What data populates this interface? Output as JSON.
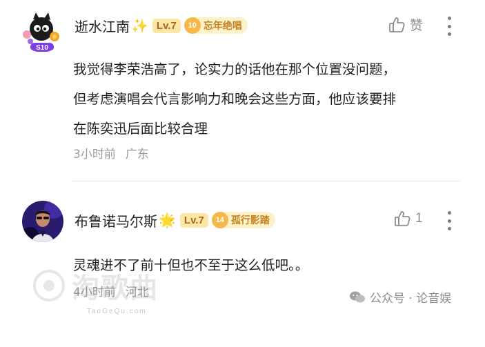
{
  "comments": [
    {
      "username": "逝水江南",
      "deco": "✨",
      "level": "Lv.7",
      "fan_badge_level": "10",
      "fan_badge_name": "忘年绝唱",
      "avatar_label": "S10",
      "like_label": "赞",
      "content_lines": [
        "我觉得李荣浩高了，论实力的话他在那个位置没问题，",
        "但考虑演唱会代言影响力和晚会这些方面，他应该要排",
        "在陈奕迅后面比较合理"
      ],
      "time": "3小时前",
      "location": "广东"
    },
    {
      "username": "布鲁诺马尔斯",
      "deco": "🌟",
      "level": "Lv.7",
      "fan_badge_level": "14",
      "fan_badge_name": "孤行影踏",
      "like_label": "1",
      "content_lines": [
        "灵魂进不了前十但也不至于这么低吧。。"
      ],
      "time": "4小时前",
      "location": "河北"
    }
  ],
  "watermark": {
    "text": "淘歌曲",
    "sub": "TaoGeQu.com"
  },
  "footer": {
    "text": "公众号 · 论音娱"
  }
}
